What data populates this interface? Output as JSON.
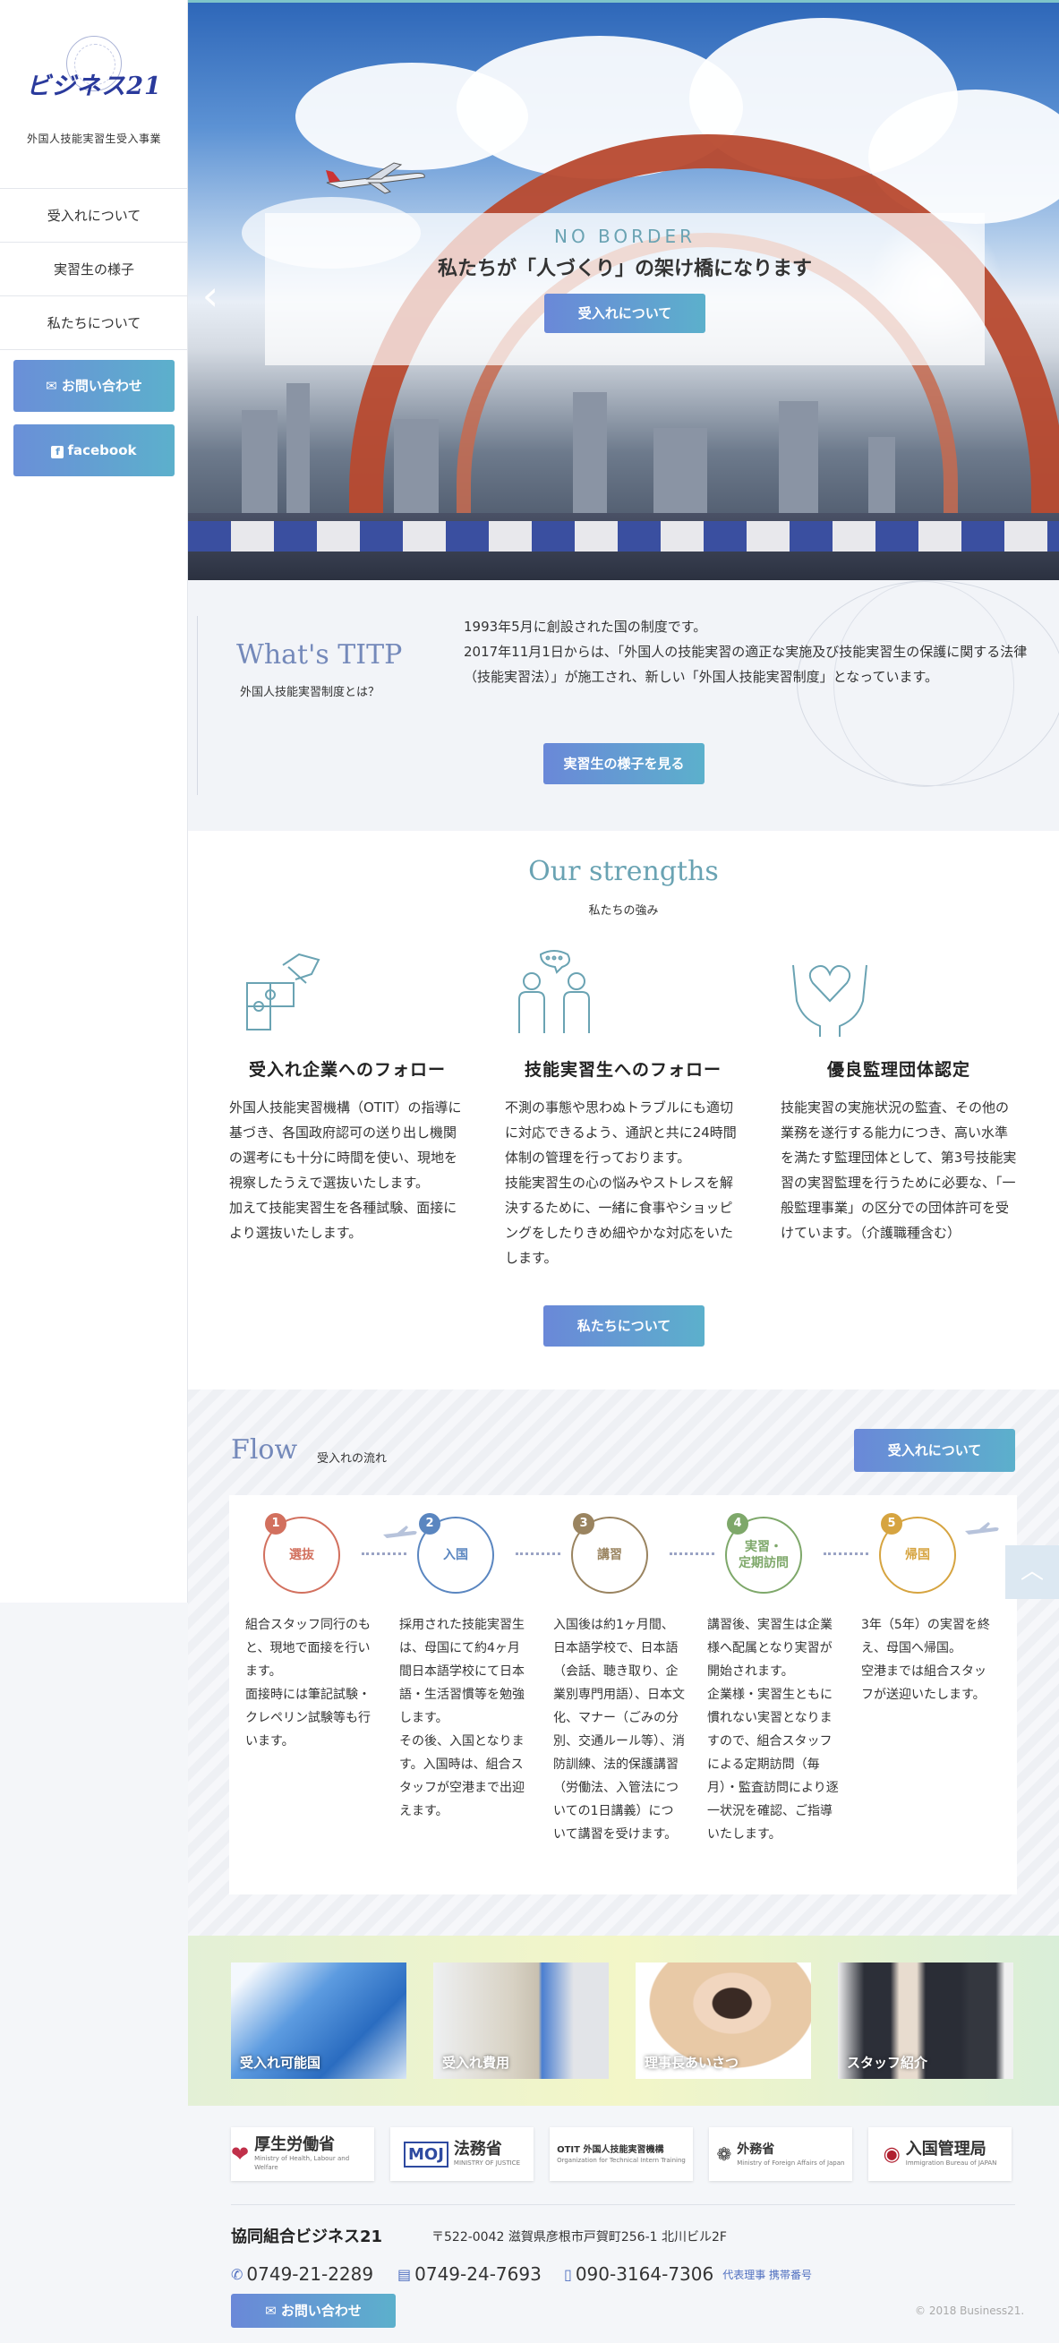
{
  "logo": {
    "mark": "ビジネス21",
    "subtitle": "外国人技能実習生受入事業"
  },
  "nav": [
    {
      "label": "受入れについて"
    },
    {
      "label": "実習生の様子"
    },
    {
      "label": "私たちについて"
    }
  ],
  "sidebar_buttons": {
    "contact": "お問い合わせ",
    "facebook": "facebook"
  },
  "hero": {
    "tag": "NO BORDER",
    "title": "私たちが「人づくり」の架け橋になります",
    "button": "受入れについて",
    "prev": "‹"
  },
  "titp": {
    "heading": "What's TITP",
    "subheading": "外国人技能実習制度とは？",
    "text": "1993年5月に創設された国の制度です。\n2017年11月1日からは、「外国人の技能実習の適正な実施及び技能実習生の保護に関する法律（技能実習法）」が施工され、新しい「外国人技能実習制度」となっています。",
    "button": "実習生の様子を見る"
  },
  "strengths": {
    "heading": "Our strengths",
    "subheading": "私たちの強み",
    "items": [
      {
        "icon": "puzzle-hand-icon",
        "title": "受入れ企業へのフォロー",
        "text": "外国人技能実習機構（OTIT）の指導に基づき、各国政府認可の送り出し機関の選考にも十分に時間を使い、現地を視察したうえで選抜いたします。\n加えて技能実習生を各種試験、面接により選抜いたします。"
      },
      {
        "icon": "people-talk-icon",
        "title": "技能実習生へのフォロー",
        "text": "不測の事態や思わぬトラブルにも適切に対応できるよう、通訳と共に24時間体制の管理を行っております。\n技能実習生の心の悩みやストレスを解決するために、一緒に食事やショッピングをしたりきめ細やかな対応をいたします。"
      },
      {
        "icon": "heart-hands-icon",
        "title": "優良監理団体認定",
        "text": "技能実習の実施状況の監査、その他の業務を遂行する能力につき、高い水準を満たす監理団体として、第3号技能実習の実習監理を行うために必要な、「一般監理事業」の区分での団体許可を受けています。（介護職種含む）"
      }
    ],
    "button": "私たちについて"
  },
  "flow": {
    "heading": "Flow",
    "subheading": "受入れの流れ",
    "button": "受入れについて",
    "steps": [
      {
        "num": "1",
        "label": "選抜",
        "color": "#d2705e",
        "text": "組合スタッフ同行のもと、現地で面接を行います。\n面接時には筆記試験・クレペリン試験等も行います。"
      },
      {
        "num": "2",
        "label": "入国",
        "color": "#5a86c0",
        "text": "採用された技能実習生は、母国にて約4ヶ月間日本語学校にて日本語・生活習慣等を勉強します。\nその後、入国となります。入国時は、組合スタッフが空港まで出迎えます。"
      },
      {
        "num": "3",
        "label": "講習",
        "color": "#9a8460",
        "text": "入国後は約1ヶ月間、日本語学校で、日本語（会話、聴き取り、企業別専門用語）、日本文化、マナー（ごみの分別、交通ルール等）、消防訓練、法的保護講習（労働法、入管法についての1日講義）について講習を受けます。"
      },
      {
        "num": "4",
        "label": "実習・\n定期訪問",
        "color": "#7ea86a",
        "text": "講習後、実習生は企業様へ配属となり実習が開始されます。\n企業様・実習生ともに慣れない実習となりますので、組合スタッフによる定期訪問（毎月）・監査訪問により逐一状況を確認、ご指導いたします。"
      },
      {
        "num": "5",
        "label": "帰国",
        "color": "#d6a440",
        "text": "3年（5年）の実習を終え、母国へ帰国。\n空港までは組合スタッフが送迎いたします。"
      }
    ]
  },
  "photos": [
    {
      "label": "受入れ可能国"
    },
    {
      "label": "受入れ費用"
    },
    {
      "label": "理事長あいさつ"
    },
    {
      "label": "スタッフ紹介"
    }
  ],
  "partners": [
    {
      "name": "厚生労働省",
      "sub": "Ministry of Health, Labour and Welfare",
      "color": "#c0304a"
    },
    {
      "name": "法務省",
      "sub": "MINISTRY OF JUSTICE",
      "color": "#2e4aa0"
    },
    {
      "name": "OTIT 外国人技能実習機構",
      "sub": "Organization for Technical Intern Training",
      "color": "#2a6ab8"
    },
    {
      "name": "外務省",
      "sub": "Ministry of Foreign Affairs of Japan",
      "color": "#333333"
    },
    {
      "name": "入国管理局",
      "sub": "Immigration Bureau of JAPAN",
      "color": "#b02030"
    }
  ],
  "footer": {
    "name": "協同組合ビジネス21",
    "address": "〒522-0042 滋賀県彦根市戸賀町256-1 北川ビル2F",
    "phone": "0749-21-2289",
    "fax": "0749-24-7693",
    "mobile": "090-3164-7306",
    "mobile_note": "代表理事 携帯番号",
    "contact": "お問い合わせ",
    "copyright": "© 2018 Business21."
  }
}
